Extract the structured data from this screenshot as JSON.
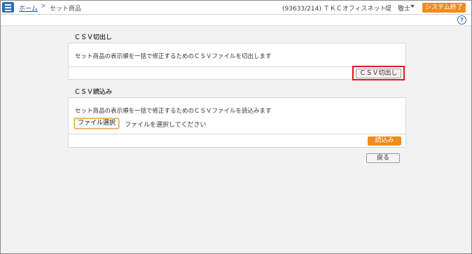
{
  "header": {
    "breadcrumb_home": "ホーム",
    "breadcrumb_sep": ">",
    "breadcrumb_current": "セット商品",
    "user_info": "(93633/214) ＴＫＣオフィスネット",
    "user_name": "堤　敬士",
    "exit_label": "システム終了"
  },
  "help_label": "?",
  "csv_export": {
    "title": "ＣＳＶ切出し",
    "description": "セット商品の表示順を一括で修正するためのＣＳＶファイルを切出します",
    "button_label": "ＣＳＶ切出し"
  },
  "csv_import": {
    "title": "ＣＳＶ読込み",
    "description": "セット商品の表示順を一括で修正するためのＣＳＶファイルを読込みます",
    "file_button_label": "ファイル選択",
    "file_placeholder": "ファイルを選択してください",
    "button_label": "読込み"
  },
  "back_label": "戻る",
  "colors": {
    "accent_orange": "#f08c1c",
    "menu_blue": "#2f6db5",
    "highlight_red": "#e0141c"
  }
}
